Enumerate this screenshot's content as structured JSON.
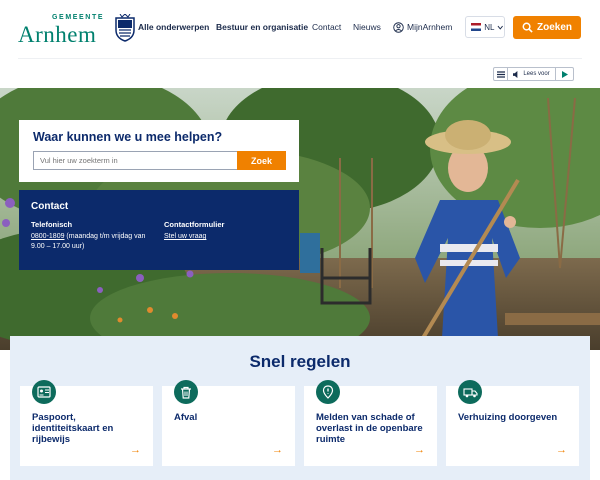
{
  "header": {
    "logo_small": "GEMEENTE",
    "logo_name": "Arnhem",
    "nav": [
      "Alle onderwerpen",
      "Bestuur en organisatie",
      "Contact",
      "Nieuws"
    ],
    "mijn": "MijnArnhem",
    "language": "NL",
    "search_button": "Zoeken"
  },
  "readspeaker": {
    "label": "Lees voor"
  },
  "search": {
    "title": "Waar kunnen we u mee helpen?",
    "placeholder": "Vul hier uw zoekterm in",
    "button": "Zoek"
  },
  "contact": {
    "title": "Contact",
    "phone_label": "Telefonisch",
    "phone_number": "0800-1809",
    "phone_hours_1": " (maandag t/m vrijdag van",
    "phone_hours_2": "9.00 – 17.00 uur)",
    "form_label": "Contactformulier",
    "form_link": "Stel uw vraag"
  },
  "snel": {
    "title": "Snel regelen",
    "cards": [
      {
        "title": "Paspoort, identiteitskaart en rijbewijs",
        "icon": "id-card-icon"
      },
      {
        "title": "Afval",
        "icon": "trash-icon"
      },
      {
        "title": "Melden van schade of overlast in de openbare ruimte",
        "icon": "report-location-icon"
      },
      {
        "title": "Verhuizing doorgeven",
        "icon": "moving-truck-icon"
      }
    ]
  },
  "colors": {
    "brand_green": "#00806e",
    "navy": "#0c2a6b",
    "orange": "#f08100",
    "snel_bg": "#e6eef8"
  }
}
